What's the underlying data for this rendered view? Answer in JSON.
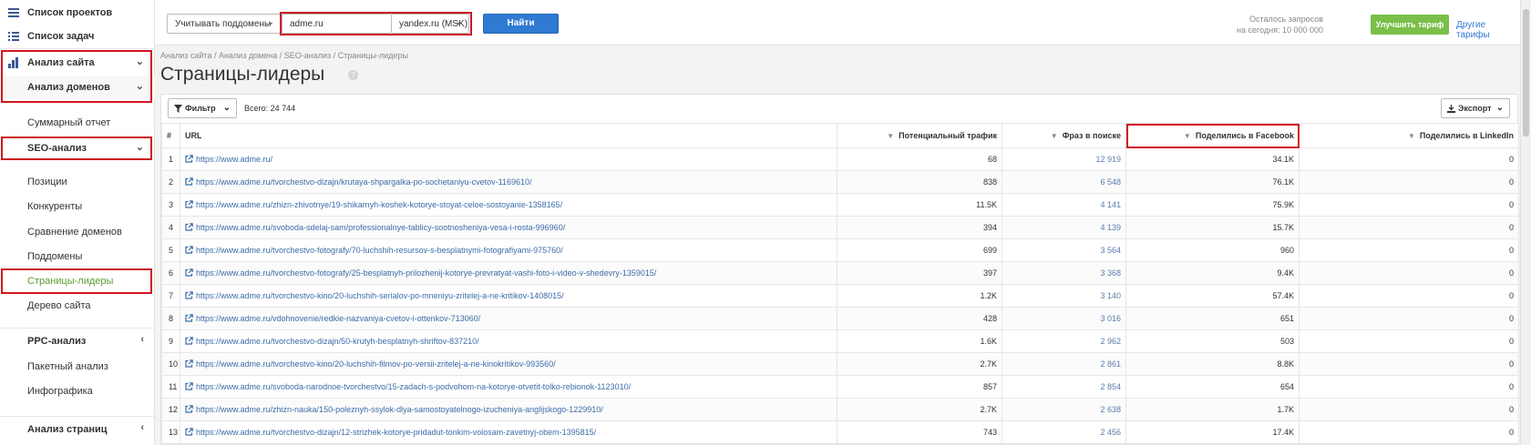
{
  "sidebar": {
    "items": [
      {
        "label": "Список проектов",
        "icon": "menu-icon"
      },
      {
        "label": "Список задач",
        "icon": "list-icon"
      },
      {
        "label": "Анализ сайта",
        "icon": "chart-icon"
      },
      {
        "label": "Анализ доменов"
      },
      {
        "label": "Суммарный отчет"
      },
      {
        "label": "SEO-анализ"
      },
      {
        "label": "Позиции"
      },
      {
        "label": "Конкуренты"
      },
      {
        "label": "Сравнение доменов"
      },
      {
        "label": "Поддомены"
      },
      {
        "label": "Страницы-лидеры"
      },
      {
        "label": "Дерево сайта"
      },
      {
        "label": "PPC-анализ"
      },
      {
        "label": "Пакетный анализ"
      },
      {
        "label": "Инфографика"
      },
      {
        "label": "Анализ страниц"
      }
    ]
  },
  "topbar": {
    "subdomains_select": "Учитывать поддомены",
    "domain_value": "adme.ru",
    "engine_select": "yandex.ru (MSK)",
    "find_label": "Найти",
    "quota_line1": "Осталось запросов",
    "quota_line2": "на сегодня: 10 000 000",
    "upgrade_label": "Улучшить тариф",
    "other_plans_label": "Другие тарифы"
  },
  "header": {
    "breadcrumb": "Анализ сайта / Анализ домена / SEO-анализ / Страницы-лидеры",
    "title": "Страницы-лидеры",
    "help": "?"
  },
  "toolbar": {
    "filter_label": "Фильтр",
    "total": "Всего: 24 744",
    "export_label": "Экспорт"
  },
  "table": {
    "headers": {
      "num": "#",
      "url": "URL",
      "traffic": "Потенциальный трафик",
      "phrases": "Фраз в поиске",
      "facebook": "Поделились в Facebook",
      "linkedin": "Поделились в LinkedIn"
    },
    "rows": [
      {
        "n": "1",
        "url": "https://www.adme.ru/",
        "traffic": "68",
        "phrases": "12 919",
        "facebook": "34.1K",
        "linkedin": "0"
      },
      {
        "n": "2",
        "url": "https://www.adme.ru/tvorchestvo-dizajn/krutaya-shpargalka-po-sochetaniyu-cvetov-1169610/",
        "traffic": "838",
        "phrases": "6 548",
        "facebook": "76.1K",
        "linkedin": "0"
      },
      {
        "n": "3",
        "url": "https://www.adme.ru/zhizn-zhivotnye/19-shikarnyh-koshek-kotorye-stoyat-celoe-sostoyanie-1358165/",
        "traffic": "11.5K",
        "phrases": "4 141",
        "facebook": "75.9K",
        "linkedin": "0"
      },
      {
        "n": "4",
        "url": "https://www.adme.ru/svoboda-sdelaj-sam/professionalnye-tablicy-sootnosheniya-vesa-i-rosta-996960/",
        "traffic": "394",
        "phrases": "4 139",
        "facebook": "15.7K",
        "linkedin": "0"
      },
      {
        "n": "5",
        "url": "https://www.adme.ru/tvorchestvo-fotografy/70-luchshih-resursov-s-besplatnymi-fotografiyami-975760/",
        "traffic": "699",
        "phrases": "3 564",
        "facebook": "960",
        "linkedin": "0"
      },
      {
        "n": "6",
        "url": "https://www.adme.ru/tvorchestvo-fotografy/25-besplatnyh-prilozhenij-kotorye-prevratyat-vashi-foto-i-video-v-shedevry-1359015/",
        "traffic": "397",
        "phrases": "3 368",
        "facebook": "9.4K",
        "linkedin": "0"
      },
      {
        "n": "7",
        "url": "https://www.adme.ru/tvorchestvo-kino/20-luchshih-serialov-po-mneniyu-zritelej-a-ne-kritikov-1408015/",
        "traffic": "1.2K",
        "phrases": "3 140",
        "facebook": "57.4K",
        "linkedin": "0"
      },
      {
        "n": "8",
        "url": "https://www.adme.ru/vdohnovenie/redkie-nazvaniya-cvetov-i-ottenkov-713060/",
        "traffic": "428",
        "phrases": "3 016",
        "facebook": "651",
        "linkedin": "0"
      },
      {
        "n": "9",
        "url": "https://www.adme.ru/tvorchestvo-dizajn/50-krutyh-besplatnyh-shriftov-837210/",
        "traffic": "1.6K",
        "phrases": "2 962",
        "facebook": "503",
        "linkedin": "0"
      },
      {
        "n": "10",
        "url": "https://www.adme.ru/tvorchestvo-kino/20-luchshih-filmov-po-versii-zritelej-a-ne-kinokritikov-993560/",
        "traffic": "2.7K",
        "phrases": "2 861",
        "facebook": "8.8K",
        "linkedin": "0"
      },
      {
        "n": "11",
        "url": "https://www.adme.ru/svoboda-narodnoe-tvorchestvo/15-zadach-s-podvohom-na-kotorye-otvetit-tolko-rebionok-1123010/",
        "traffic": "857",
        "phrases": "2 854",
        "facebook": "654",
        "linkedin": "0"
      },
      {
        "n": "12",
        "url": "https://www.adme.ru/zhizn-nauka/150-poleznyh-ssylok-dlya-samostoyatelnogo-izucheniya-anglijskogo-1229910/",
        "traffic": "2.7K",
        "phrases": "2 638",
        "facebook": "1.7K",
        "linkedin": "0"
      },
      {
        "n": "13",
        "url": "https://www.adme.ru/tvorchestvo-dizajn/12-strizhek-kotorye-pridadut-tonkim-volosam-zavetnyj-obem-1395815/",
        "traffic": "743",
        "phrases": "2 456",
        "facebook": "17.4K",
        "linkedin": "0"
      }
    ]
  },
  "colors": {
    "highlight": "#d0161e",
    "primary_button": "#2f7ad2",
    "upgrade_button": "#7bbf4a",
    "active_nav": "#5a9e2f",
    "link": "#3c6ca8"
  }
}
